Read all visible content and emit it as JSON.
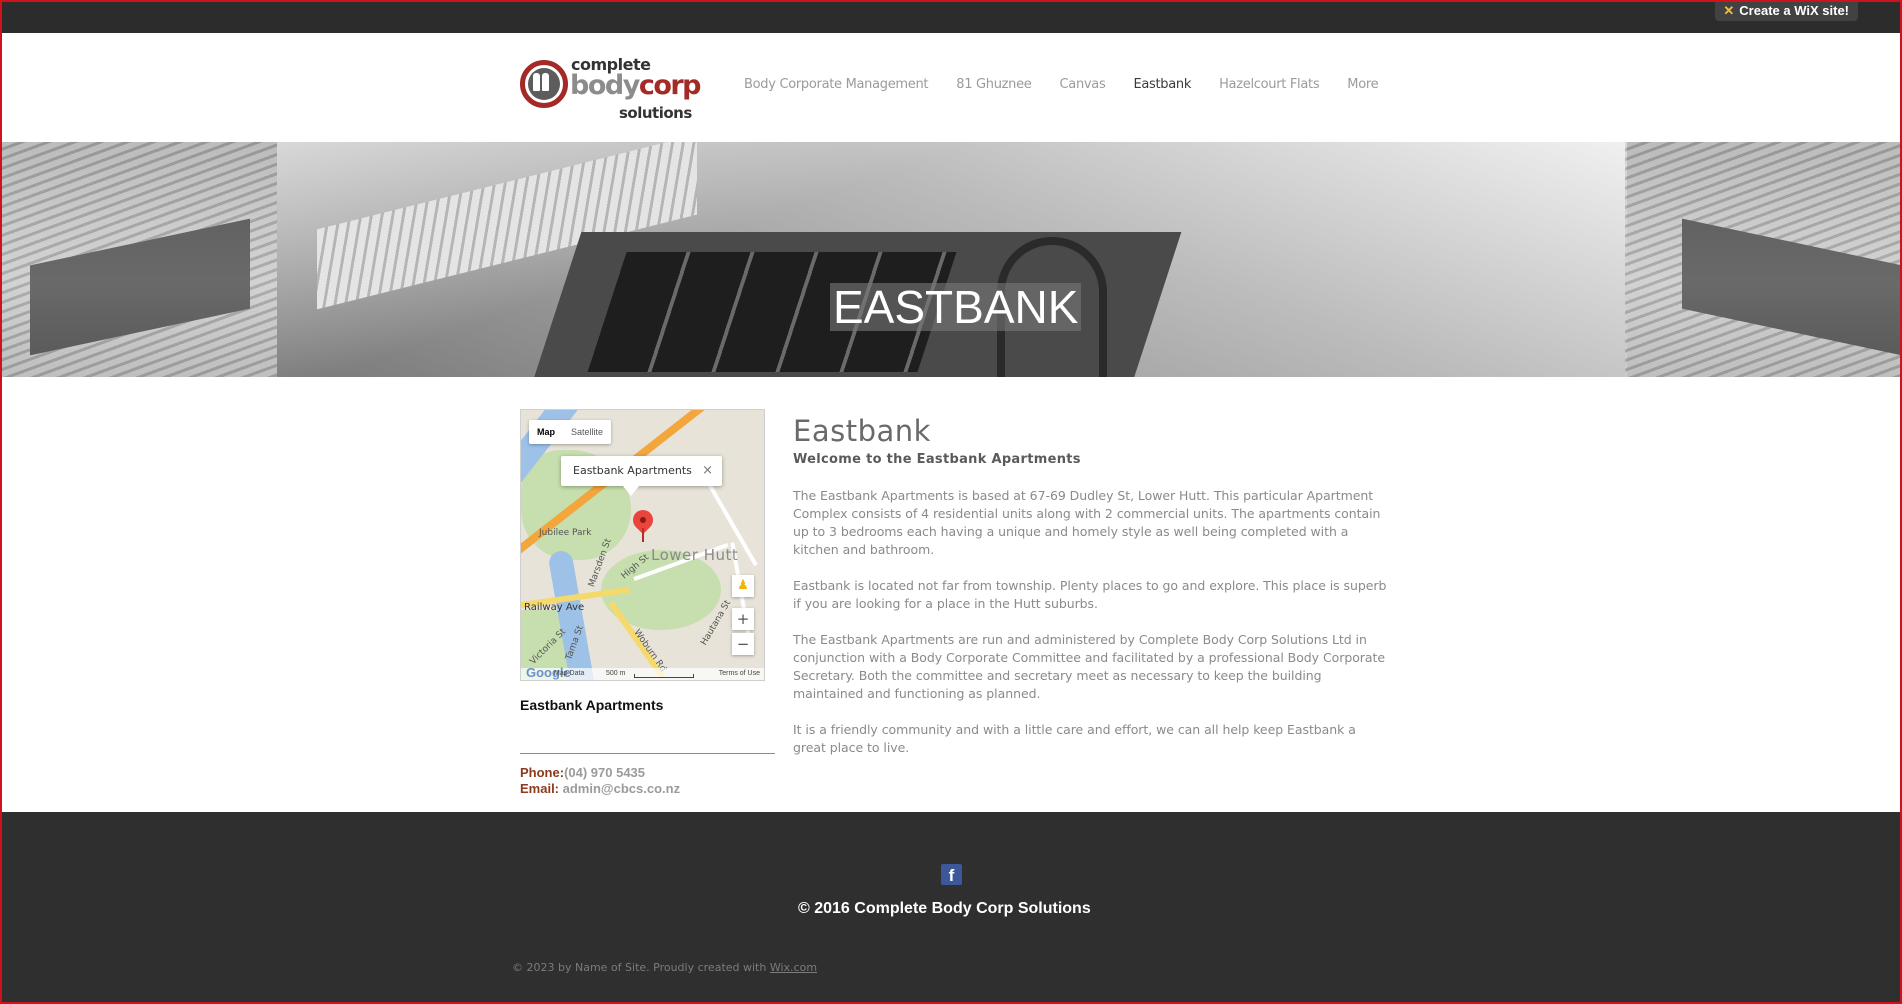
{
  "wix_bar": {
    "create_label": "Create a WiX site!"
  },
  "logo": {
    "line1": "complete",
    "line2a": "body",
    "line2b": "corp",
    "line3": "solutions"
  },
  "nav": {
    "items": [
      {
        "label": "Body Corporate Management",
        "active": false
      },
      {
        "label": "81 Ghuznee",
        "active": false
      },
      {
        "label": "Canvas",
        "active": false
      },
      {
        "label": "Eastbank",
        "active": true
      },
      {
        "label": "Hazelcourt Flats",
        "active": false
      },
      {
        "label": "More",
        "active": false
      }
    ]
  },
  "banner": {
    "title": "EASTBANK"
  },
  "map": {
    "tab_map": "Map",
    "tab_satellite": "Satellite",
    "popup_label": "Eastbank Apartments",
    "popup_close": "×",
    "area_label": "Lower Hutt",
    "street_labels": [
      "Jubilee Park",
      "Railway Ave",
      "High St",
      "Marsden St",
      "Victoria St",
      "Tama St",
      "Woburn Rd",
      "Hautana St"
    ],
    "zoom_in": "+",
    "zoom_out": "−",
    "footer_logo": "Google",
    "footer_data": "Map Data",
    "footer_scale": "500 m",
    "footer_terms": "Terms of Use",
    "caption": "Eastbank Apartments"
  },
  "contact": {
    "phone_label": "Phone:",
    "phone_value": "(04) 970 5435",
    "email_label": "Email:",
    "email_value": "admin@cbcs.co.nz"
  },
  "article": {
    "title": "Eastbank",
    "subtitle": "Welcome to the Eastbank Apartments",
    "paragraphs": [
      "The Eastbank Apartments is based at 67-69 Dudley St, Lower Hutt. This particular Apartment Complex consists of 4 residential units along with 2 commercial units. The apartments contain up to 3 bedrooms each having a unique and homely style as well being completed with a kitchen and bathroom.",
      "Eastbank is located not far from township. Plenty places to go and explore. This place is superb if you are looking for a place in the Hutt suburbs.",
      "The Eastbank Apartments are run and administered by Complete Body Corp Solutions Ltd in conjunction with a Body Corporate Committee and facilitated by a professional Body Corporate Secretary.  Both the committee and secretary meet as necessary to keep the building maintained and functioning as planned.",
      "It is a friendly community and with a little care and effort, we can all help keep Eastbank a great place to live."
    ]
  },
  "footer": {
    "facebook_glyph": "f",
    "copyright": "© 2016 Complete Body Corp Solutions",
    "credit_text": "© 2023 by Name of Site. Proudly created with ",
    "credit_link": "Wix.com"
  },
  "colors": {
    "accent": "#a32a26",
    "footer_bg": "#2f2f2f",
    "frame": "#d0131b"
  }
}
